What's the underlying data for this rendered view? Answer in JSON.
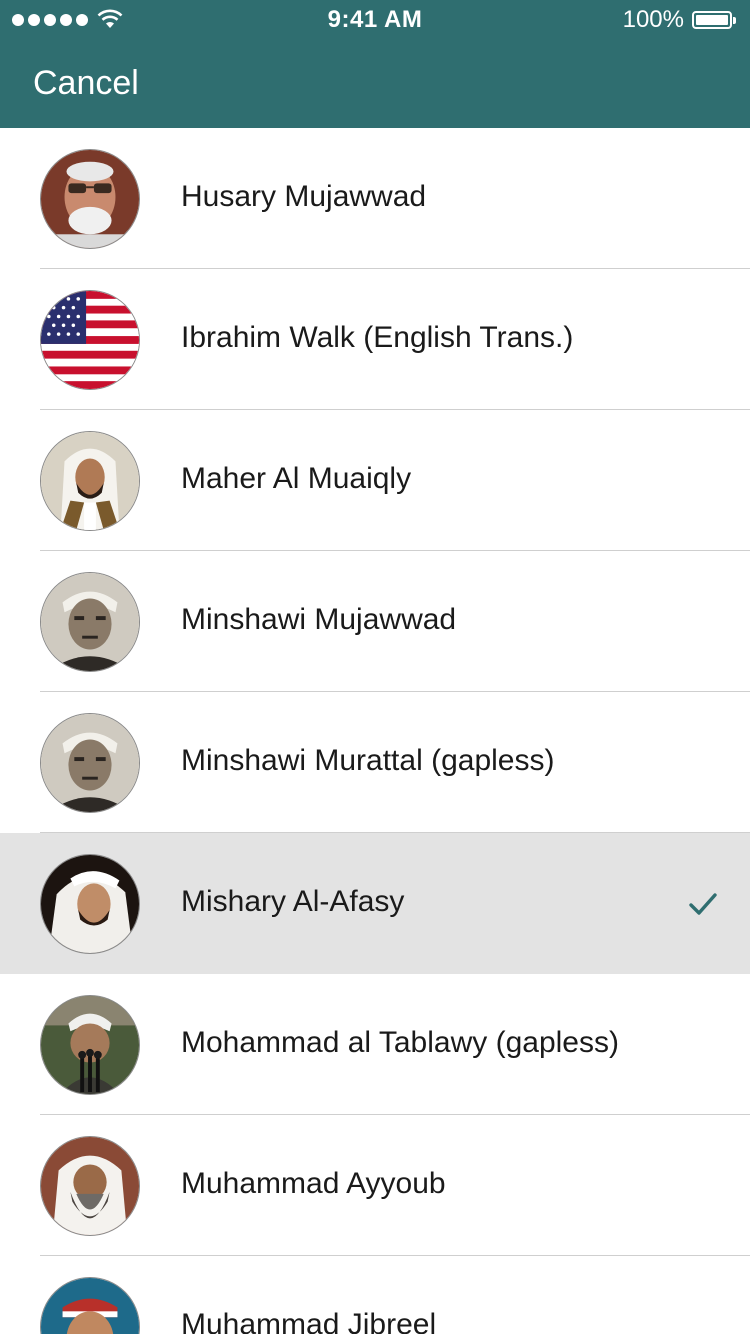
{
  "status_bar": {
    "time": "9:41 AM",
    "battery": "100%"
  },
  "nav": {
    "cancel_label": "Cancel"
  },
  "reciters": [
    {
      "name": "Husary Mujawwad",
      "avatar": "portrait-glasses",
      "selected": false
    },
    {
      "name": "Ibrahim Walk (English Trans.)",
      "avatar": "us-flag",
      "selected": false
    },
    {
      "name": "Maher Al Muaiqly",
      "avatar": "portrait-white-ghutra",
      "selected": false
    },
    {
      "name": "Minshawi Mujawwad",
      "avatar": "portrait-sepia",
      "selected": false
    },
    {
      "name": "Minshawi Murattal (gapless)",
      "avatar": "portrait-sepia",
      "selected": false
    },
    {
      "name": "Mishary Al-Afasy",
      "avatar": "portrait-white-ghutra-dark",
      "selected": true
    },
    {
      "name": "Mohammad al Tablawy (gapless)",
      "avatar": "portrait-microphone",
      "selected": false
    },
    {
      "name": "Muhammad Ayyoub",
      "avatar": "portrait-beard",
      "selected": false
    },
    {
      "name": "Muhammad Jibreel",
      "avatar": "portrait-cap",
      "selected": false
    }
  ],
  "colors": {
    "header": "#2f6e70",
    "selected_row": "#e3e3e3",
    "checkmark": "#2f6e70"
  },
  "icons": {
    "selected_indicator": "checkmark-icon"
  }
}
